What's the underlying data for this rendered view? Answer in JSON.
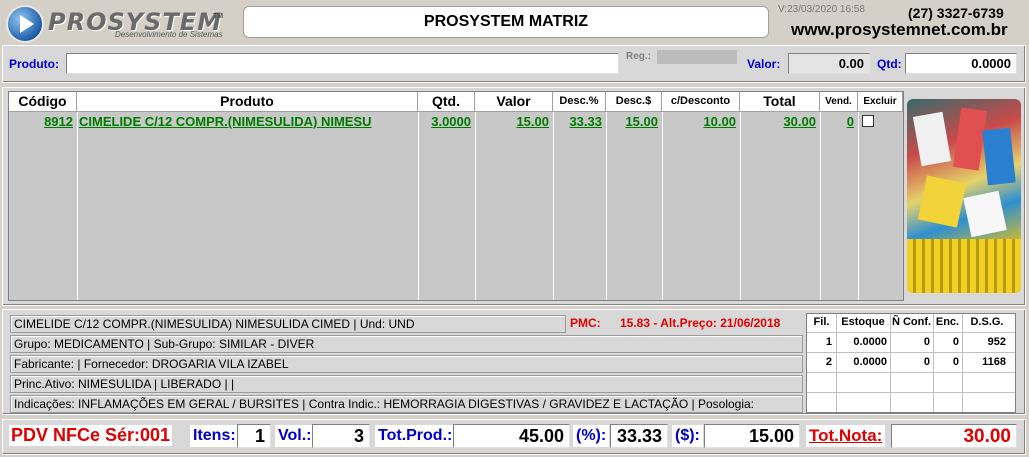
{
  "header": {
    "logo_text": "PROSYSTEM",
    "logo_tm": "TM",
    "logo_sub": "Desenvolvimento de Sistemas",
    "title": "PROSYSTEM MATRIZ",
    "version": "V:23/03/2020 16:58",
    "phone": "(27) 3327-6739",
    "site": "www.prosystemnet.com.br"
  },
  "search": {
    "produto_label": "Produto:",
    "produto_value": "",
    "reg_label": "Reg.:",
    "valor_label": "Valor:",
    "valor_value": "0.00",
    "qtd_label": "Qtd:",
    "qtd_value": "0.0000"
  },
  "table": {
    "headers": [
      "Código",
      "Produto",
      "Qtd.",
      "Valor",
      "Desc.%",
      "Desc.$",
      "c/Desconto",
      "Total",
      "Vend.",
      "Excluir"
    ],
    "rows": [
      {
        "codigo": "8912",
        "produto": "CIMELIDE C/12 COMPR.(NIMESULIDA) NIMESU",
        "qtd": "3.0000",
        "valor": "15.00",
        "desc_pct": "33.33",
        "desc_val": "15.00",
        "com_desconto": "10.00",
        "total": "30.00",
        "vend": "0"
      }
    ]
  },
  "info": {
    "line1": "CIMELIDE C/12 COMPR.(NIMESULIDA) NIMESULIDA CIMED | Und: UND",
    "pmc_label": "PMC:",
    "pmc_value": "15.83 - Alt.Preço: 21/06/2018",
    "line2": "Grupo: MEDICAMENTO | Sub-Grupo: SIMILAR - DIVER",
    "line3": "Fabricante:  |  Fornecedor: DROGARIA VILA IZABEL",
    "line4": "Princ.Ativo: NIMESULIDA | LIBERADO |  |",
    "line5": "Indicações: INFLAMAÇÕES EM GERAL  /  BURSITES | Contra Indic.: HEMORRAGIA DIGESTIVAS / GRAVIDEZ E LACTAÇÃO | Posologia:"
  },
  "stock": {
    "headers": [
      "Fil.",
      "Estoque",
      "Ñ Conf.",
      "Enc.",
      "D.S.G."
    ],
    "rows": [
      [
        "1",
        "0.0000",
        "0",
        "0",
        "952"
      ],
      [
        "2",
        "0.0000",
        "0",
        "0",
        "1168"
      ]
    ]
  },
  "footer": {
    "pdv": "PDV NFCe Sér:001",
    "itens_label": "Itens:",
    "itens": "1",
    "vol_label": "Vol.:",
    "vol": "3",
    "totprod_label": "Tot.Prod.:",
    "totprod": "45.00",
    "pct_label": "(%):",
    "pct": "33.33",
    "dol_label": "($):",
    "dol": "15.00",
    "totnota_label": "Tot.Nota:",
    "totnota": "30.00"
  }
}
